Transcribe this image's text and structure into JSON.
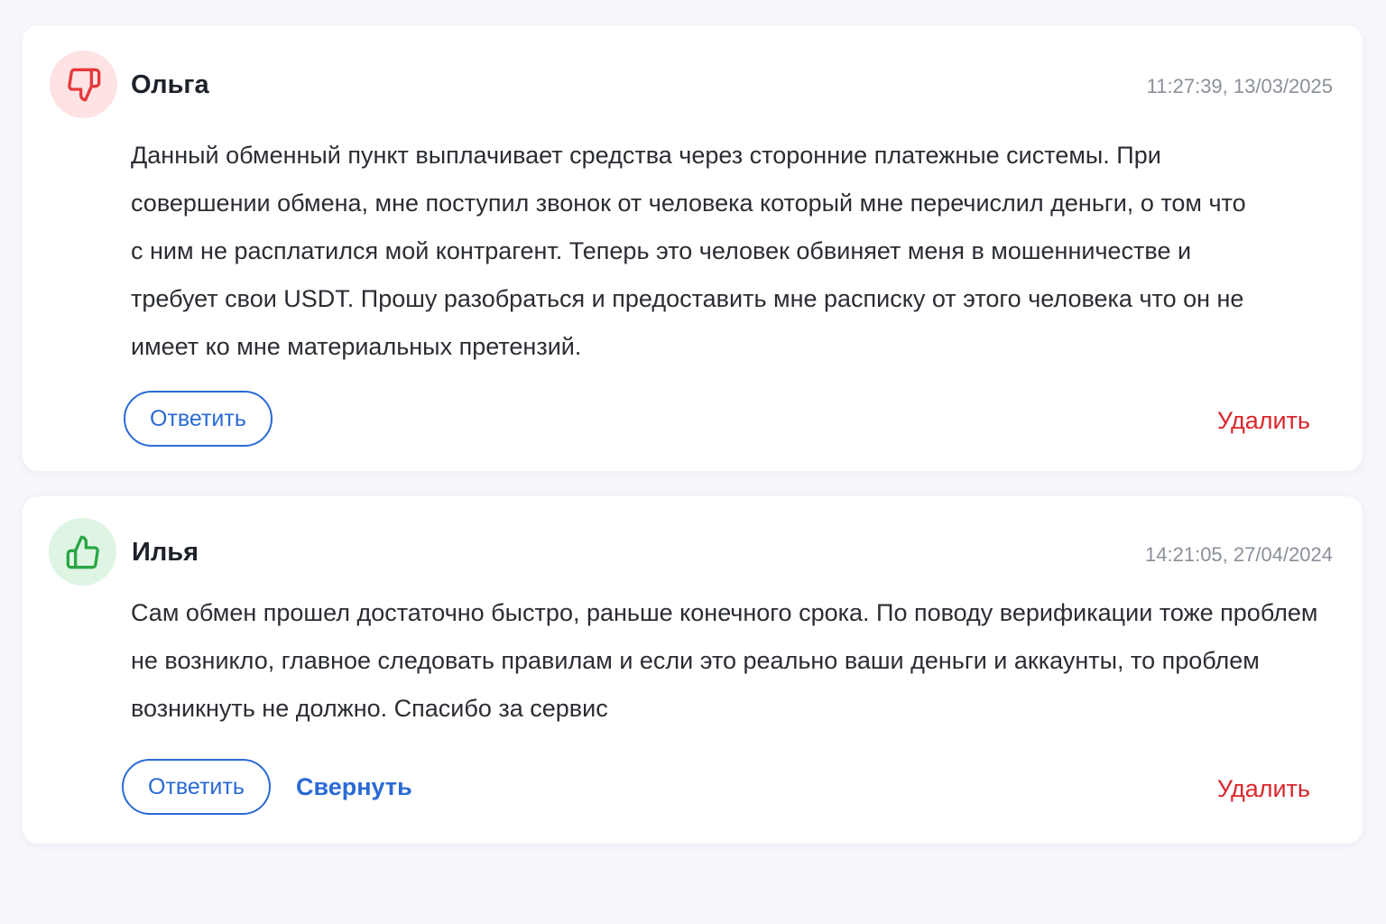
{
  "reviews": [
    {
      "author": "Ольга",
      "timestamp": "11:27:39, 13/03/2025",
      "sentiment_icon": "thumbs-down-icon",
      "text": "Данный обменный пункт выплачивает средства через сторонние платежные системы. При совершении обмена, мне поступил звонок от человека который мне перечислил деньги, о том что с ним не расплатился мой контрагент. Теперь это человек обвиняет меня в мошенничестве и требует свои USDT. Прошу разобраться и предоставить мне расписку от этого человека что он не имеет ко мне материальных претензий.",
      "reply_label": "Ответить",
      "delete_label": "Удалить"
    },
    {
      "author": "Илья",
      "timestamp": "14:21:05, 27/04/2024",
      "sentiment_icon": "thumbs-up-icon",
      "text": "Сам обмен прошел достаточно быстро, раньше конечного срока. По поводу верификации тоже проблем не возникло, главное следовать правилам и если это реально ваши деньги и аккаунты, то проблем возникнуть не должно. Спасибо за сервис",
      "reply_label": "Ответить",
      "collapse_label": "Свернуть",
      "delete_label": "Удалить"
    }
  ],
  "colors": {
    "accent": "#2a6ad6",
    "danger": "#d9262b",
    "negative_bg": "#fde3e3",
    "positive_bg": "#dff5e4",
    "negative_icon": "#e5383b",
    "positive_icon": "#2aa745"
  }
}
